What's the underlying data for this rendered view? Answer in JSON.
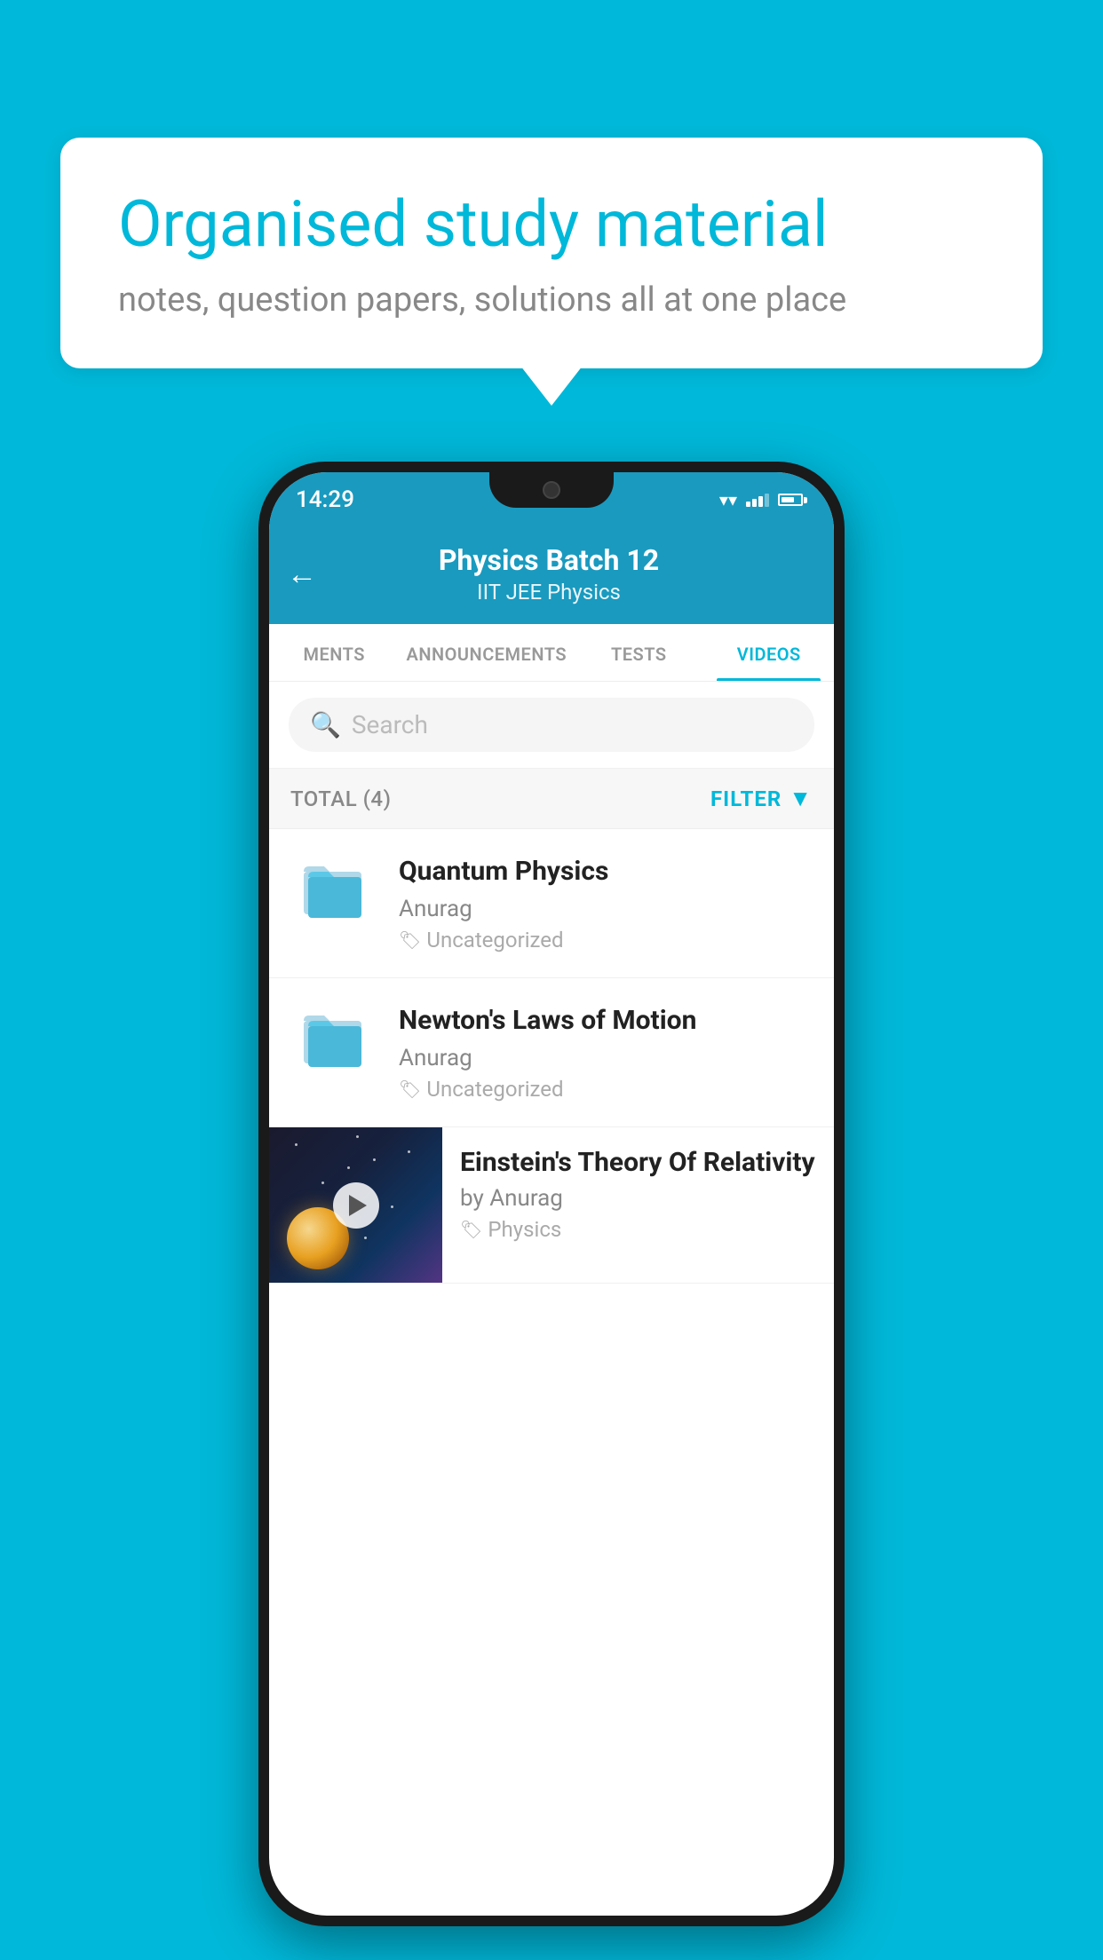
{
  "background_color": "#00b8d9",
  "speech_bubble": {
    "title": "Organised study material",
    "subtitle": "notes, question papers, solutions all at one place"
  },
  "phone": {
    "status_bar": {
      "time": "14:29"
    },
    "header": {
      "back_label": "←",
      "title": "Physics Batch 12",
      "subtitle": "IIT JEE    Physics"
    },
    "tabs": [
      {
        "label": "MENTS",
        "active": false
      },
      {
        "label": "ANNOUNCEMENTS",
        "active": false
      },
      {
        "label": "TESTS",
        "active": false
      },
      {
        "label": "VIDEOS",
        "active": true
      }
    ],
    "search": {
      "placeholder": "Search"
    },
    "filter_bar": {
      "total_label": "TOTAL (4)",
      "filter_label": "FILTER"
    },
    "videos": [
      {
        "id": 1,
        "title": "Quantum Physics",
        "author": "Anurag",
        "tag": "Uncategorized",
        "type": "folder",
        "has_thumb": false
      },
      {
        "id": 2,
        "title": "Newton's Laws of Motion",
        "author": "Anurag",
        "tag": "Uncategorized",
        "type": "folder",
        "has_thumb": false
      },
      {
        "id": 3,
        "title": "Einstein's Theory Of Relativity",
        "author": "by Anurag",
        "tag": "Physics",
        "type": "video",
        "has_thumb": true
      }
    ]
  }
}
